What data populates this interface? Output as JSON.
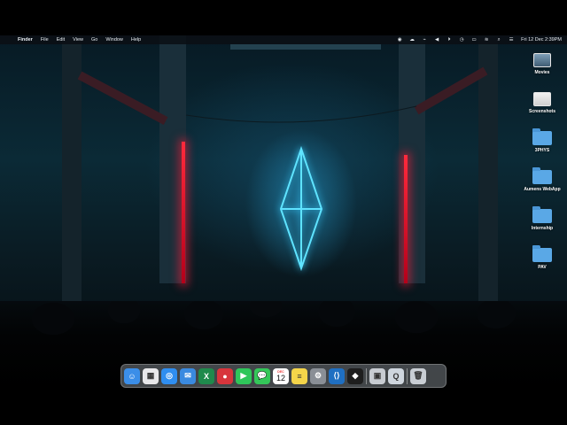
{
  "menubar": {
    "app_name": "Finder",
    "menus": [
      "File",
      "Edit",
      "View",
      "Go",
      "Window",
      "Help"
    ],
    "clock": "Fri 12 Dec  2:39PM"
  },
  "desktop_icons": [
    {
      "label": "Movies",
      "kind": "image"
    },
    {
      "label": "Screenshots",
      "kind": "image"
    },
    {
      "label": "3PHYS",
      "kind": "folder"
    },
    {
      "label": "Aumens WebApp",
      "kind": "folder"
    },
    {
      "label": "Internship",
      "kind": "folder"
    },
    {
      "label": "PAV",
      "kind": "folder"
    }
  ],
  "dock": {
    "calendar_month": "DEC",
    "calendar_day": "12",
    "apps": [
      {
        "name": "finder-icon",
        "color": "#3b8ee8",
        "glyph": "☺"
      },
      {
        "name": "launchpad-icon",
        "color": "#e8e8ea",
        "glyph": "▦"
      },
      {
        "name": "safari-icon",
        "color": "#2f8ef0",
        "glyph": "◎"
      },
      {
        "name": "mail-icon",
        "color": "#3a8ae0",
        "glyph": "✉"
      },
      {
        "name": "excel-icon",
        "color": "#1f8a4c",
        "glyph": "X"
      },
      {
        "name": "photo-booth-icon",
        "color": "#d8353c",
        "glyph": "●"
      },
      {
        "name": "facetime-icon",
        "color": "#2fc65a",
        "glyph": "▶"
      },
      {
        "name": "messages-icon",
        "color": "#34c759",
        "glyph": "💬"
      },
      {
        "name": "calendar-icon",
        "color": "#ffffff",
        "glyph": ""
      },
      {
        "name": "notes-icon",
        "color": "#f5d54a",
        "glyph": "≡"
      },
      {
        "name": "system-settings-icon",
        "color": "#8a8f96",
        "glyph": "⚙"
      },
      {
        "name": "vscode-icon",
        "color": "#1f6fc2",
        "glyph": "⟨⟩"
      },
      {
        "name": "figma-icon",
        "color": "#1e1e1e",
        "glyph": "◆"
      },
      {
        "name": "preview-icon",
        "color": "#c8ccd2",
        "glyph": "▣"
      },
      {
        "name": "quicktime-icon",
        "color": "#cfd6de",
        "glyph": "Q"
      },
      {
        "name": "trash-icon",
        "color": "#c9ced4",
        "glyph": "🗑"
      }
    ]
  },
  "colors": {
    "neon_cyan": "#39d0ff",
    "neon_red": "#ff2a3c"
  }
}
